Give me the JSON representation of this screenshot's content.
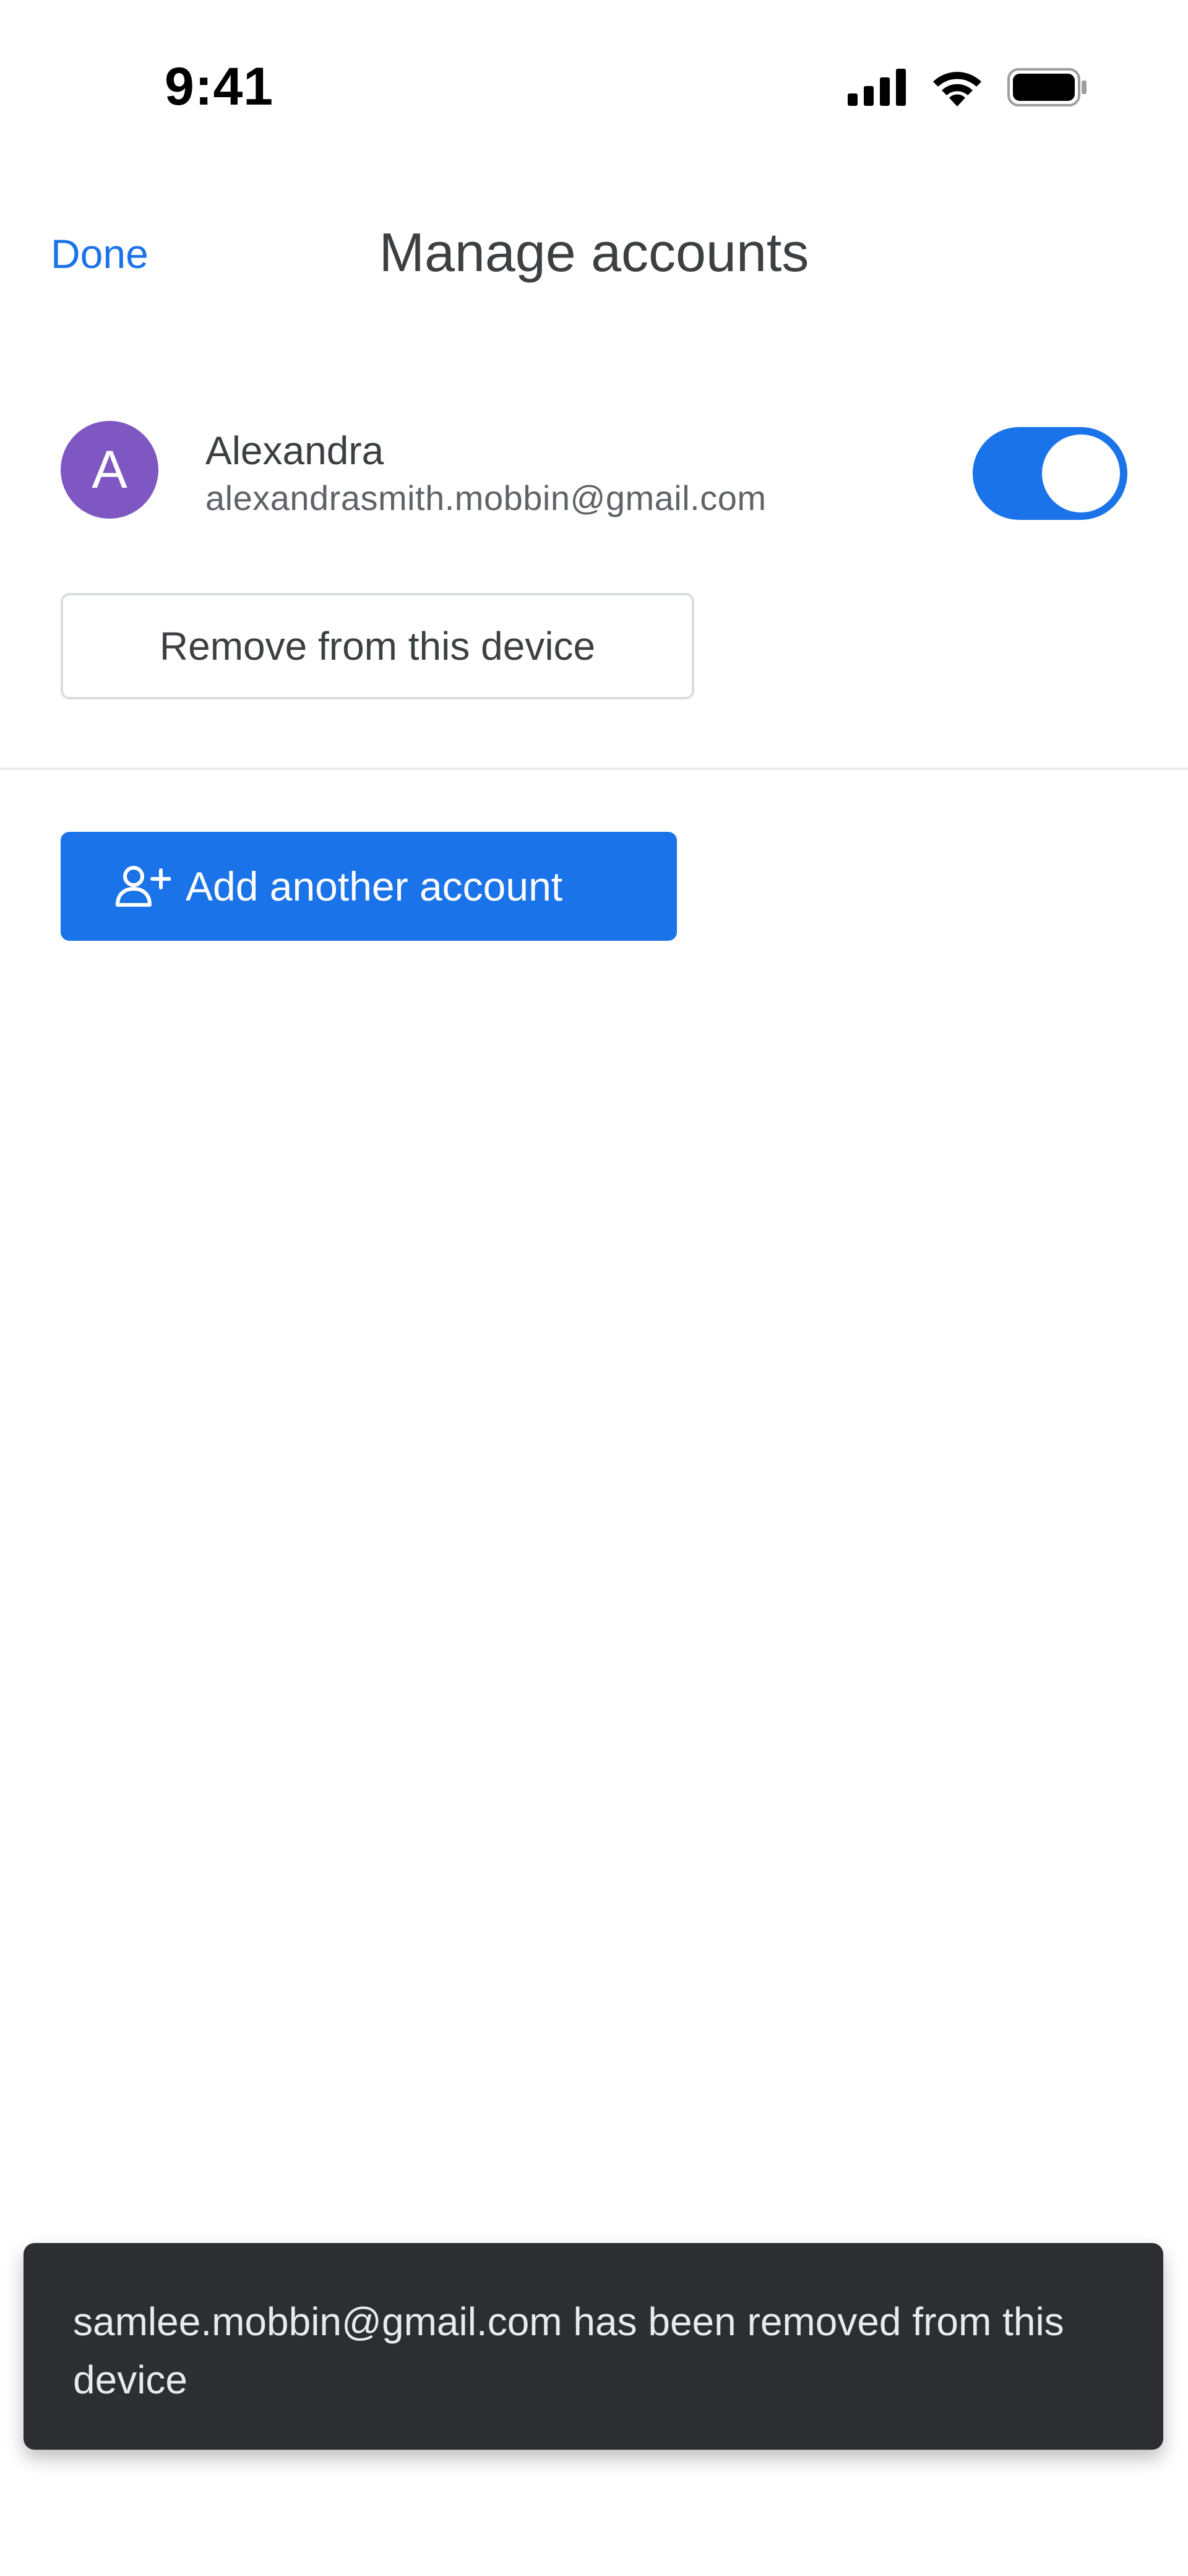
{
  "status_bar": {
    "time": "9:41",
    "icons": [
      "cellular-signal-icon",
      "wifi-icon",
      "battery-icon"
    ]
  },
  "header": {
    "done_label": "Done",
    "title": "Manage accounts"
  },
  "account": {
    "avatar_initial": "A",
    "avatar_color": "#7e57c2",
    "name": "Alexandra",
    "email": "alexandrasmith.mobbin@gmail.com",
    "sync_enabled": true
  },
  "actions": {
    "remove_label": "Remove from this device",
    "add_account_label": "Add another account",
    "add_account_icon": "person-add-icon"
  },
  "snackbar": {
    "message": "samlee.mobbin@gmail.com has been removed from this device"
  },
  "colors": {
    "accent": "#1a73e8",
    "snackbar_bg": "#2d2e31"
  }
}
